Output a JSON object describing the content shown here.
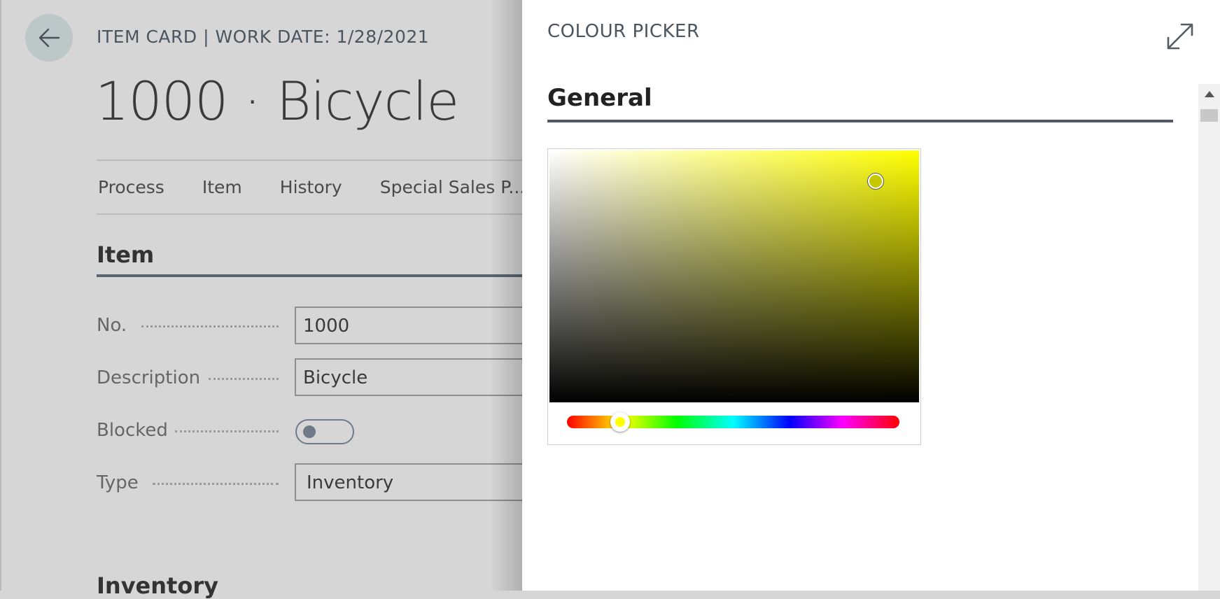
{
  "item_card": {
    "caption": "ITEM CARD | WORK DATE: 1/28/2021",
    "title": "1000 · Bicycle",
    "menu": [
      "Process",
      "Item",
      "History",
      "Special Sales P...c"
    ],
    "section_title": "Item",
    "fields": {
      "no_label": "No.",
      "no_value": "1000",
      "description_label": "Description",
      "description_value": "Bicycle",
      "blocked_label": "Blocked",
      "blocked_on": false,
      "type_label": "Type",
      "type_value": "Inventory"
    },
    "next_section": "Inventory"
  },
  "colour_picker": {
    "title": "COLOUR PICKER",
    "group_title": "General",
    "hue_fraction": 0.16,
    "saturation_fraction": 0.88,
    "value_fraction": 0.88,
    "selected_hue_color": "#ffff00"
  },
  "icons": {
    "back": "arrow-left-icon",
    "expand": "expand-diagonal-icon",
    "scroll_up": "triangle-up-icon"
  },
  "colors": {
    "overlay_bg": "#d6d6d6",
    "panel_bg": "#ffffff",
    "accent_rule": "#505a66"
  }
}
